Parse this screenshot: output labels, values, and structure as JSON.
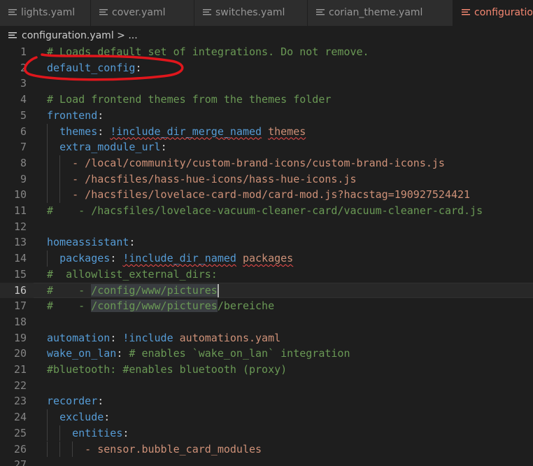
{
  "tabs": [
    {
      "label": "lights.yaml",
      "active": false,
      "icon": "list-lines-icon"
    },
    {
      "label": "cover.yaml",
      "active": false,
      "icon": "list-lines-icon"
    },
    {
      "label": "switches.yaml",
      "active": false,
      "icon": "list-lines-icon"
    },
    {
      "label": "corian_theme.yaml",
      "active": false,
      "icon": "list-lines-icon"
    },
    {
      "label": "configuration",
      "active": true,
      "icon": "list-lines-icon"
    }
  ],
  "breadcrumb": {
    "file": "configuration.yaml",
    "separator": ">",
    "more": "..."
  },
  "editor": {
    "current_line": 16,
    "lines": [
      {
        "n": "1",
        "segments": [
          {
            "t": "# Loads default set of integrations. Do not remove.",
            "c": "comment"
          }
        ]
      },
      {
        "n": "2",
        "segments": [
          {
            "t": "default_config",
            "c": "key"
          },
          {
            "t": ":",
            "c": "punct"
          }
        ]
      },
      {
        "n": "3",
        "segments": []
      },
      {
        "n": "4",
        "segments": [
          {
            "t": "# Load frontend themes from the themes folder",
            "c": "comment"
          }
        ]
      },
      {
        "n": "5",
        "segments": [
          {
            "t": "frontend",
            "c": "key"
          },
          {
            "t": ":",
            "c": "punct"
          }
        ]
      },
      {
        "n": "6",
        "segments": [
          {
            "t": "  ",
            "c": "plain"
          },
          {
            "t": "themes",
            "c": "key"
          },
          {
            "t": ": ",
            "c": "punct"
          },
          {
            "t": "!include_dir_merge_named",
            "c": "keyword",
            "squiggle": true
          },
          {
            "t": " ",
            "c": "plain"
          },
          {
            "t": "themes",
            "c": "string",
            "squiggle": true
          }
        ]
      },
      {
        "n": "7",
        "segments": [
          {
            "t": "  ",
            "c": "plain"
          },
          {
            "t": "extra_module_url",
            "c": "key"
          },
          {
            "t": ":",
            "c": "punct"
          }
        ]
      },
      {
        "n": "8",
        "segments": [
          {
            "t": "    - /local/community/custom-brand-icons/custom-brand-icons.js",
            "c": "string"
          }
        ]
      },
      {
        "n": "9",
        "segments": [
          {
            "t": "    - /hacsfiles/hass-hue-icons/hass-hue-icons.js",
            "c": "string"
          }
        ]
      },
      {
        "n": "10",
        "segments": [
          {
            "t": "    - /hacsfiles/lovelace-card-mod/card-mod.js?hacstag=190927524421",
            "c": "string"
          }
        ]
      },
      {
        "n": "11",
        "segments": [
          {
            "t": "#    - /hacsfiles/lovelace-vacuum-cleaner-card/vacuum-cleaner-card.js",
            "c": "comment"
          }
        ]
      },
      {
        "n": "12",
        "segments": []
      },
      {
        "n": "13",
        "segments": [
          {
            "t": "homeassistant",
            "c": "key"
          },
          {
            "t": ":",
            "c": "punct"
          }
        ]
      },
      {
        "n": "14",
        "segments": [
          {
            "t": "  ",
            "c": "plain"
          },
          {
            "t": "packages",
            "c": "key"
          },
          {
            "t": ": ",
            "c": "punct"
          },
          {
            "t": "!include_dir_named",
            "c": "keyword",
            "squiggle": true
          },
          {
            "t": " ",
            "c": "plain"
          },
          {
            "t": "packages",
            "c": "string",
            "squiggle": true
          }
        ]
      },
      {
        "n": "15",
        "segments": [
          {
            "t": "#  allowlist_external_dirs:",
            "c": "comment"
          }
        ]
      },
      {
        "n": "16",
        "segments": [
          {
            "t": "#    - ",
            "c": "comment"
          },
          {
            "t": "/config/www/pictures",
            "c": "comment",
            "selected": true
          }
        ]
      },
      {
        "n": "17",
        "segments": [
          {
            "t": "#    - ",
            "c": "comment"
          },
          {
            "t": "/config/www/pictures",
            "c": "comment",
            "selected": true
          },
          {
            "t": "/bereiche",
            "c": "comment"
          }
        ]
      },
      {
        "n": "18",
        "segments": []
      },
      {
        "n": "19",
        "segments": [
          {
            "t": "automation",
            "c": "key"
          },
          {
            "t": ": ",
            "c": "punct"
          },
          {
            "t": "!include",
            "c": "keyword"
          },
          {
            "t": " ",
            "c": "plain"
          },
          {
            "t": "automations.yaml",
            "c": "string"
          }
        ]
      },
      {
        "n": "20",
        "segments": [
          {
            "t": "wake_on_lan",
            "c": "key"
          },
          {
            "t": ": ",
            "c": "punct"
          },
          {
            "t": "# enables `wake_on_lan` integration",
            "c": "comment"
          }
        ]
      },
      {
        "n": "21",
        "segments": [
          {
            "t": "#bluetooth: #enables bluetooth (proxy)",
            "c": "comment"
          }
        ]
      },
      {
        "n": "22",
        "segments": []
      },
      {
        "n": "23",
        "segments": [
          {
            "t": "recorder",
            "c": "key"
          },
          {
            "t": ":",
            "c": "punct"
          }
        ]
      },
      {
        "n": "24",
        "segments": [
          {
            "t": "  ",
            "c": "plain"
          },
          {
            "t": "exclude",
            "c": "key"
          },
          {
            "t": ":",
            "c": "punct"
          }
        ]
      },
      {
        "n": "25",
        "segments": [
          {
            "t": "    ",
            "c": "plain"
          },
          {
            "t": "entities",
            "c": "key"
          },
          {
            "t": ":",
            "c": "punct"
          }
        ]
      },
      {
        "n": "26",
        "segments": [
          {
            "t": "      - sensor.bubble_card_modules",
            "c": "string"
          }
        ]
      },
      {
        "n": "27",
        "segments": []
      }
    ]
  },
  "annotation": {
    "shape": "hand-drawn-ellipse",
    "color": "#e0161c",
    "target_line": 2
  }
}
